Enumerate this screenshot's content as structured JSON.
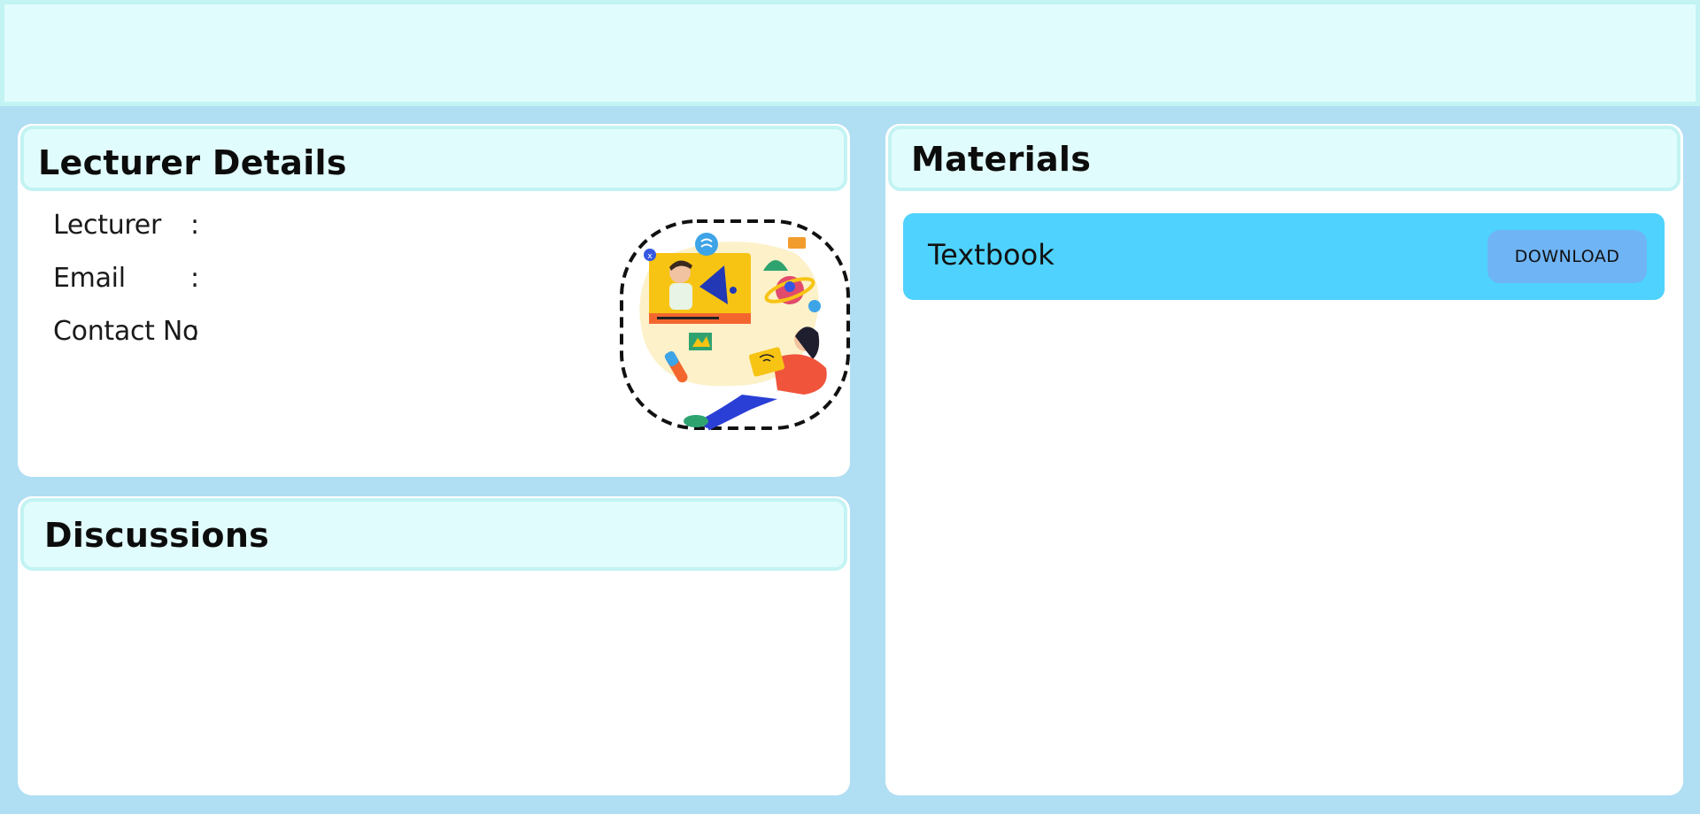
{
  "lecturer_panel": {
    "title": "Lecturer Details",
    "rows": [
      {
        "label": "Lecturer",
        "separator": ":",
        "value": ""
      },
      {
        "label": "Email",
        "separator": ":",
        "value": ""
      },
      {
        "label": "Contact No",
        "separator": ":",
        "value": ""
      }
    ],
    "illustration_icon": "online-learning-illustration"
  },
  "discussions_panel": {
    "title": "Discussions"
  },
  "materials_panel": {
    "title": "Materials",
    "items": [
      {
        "name": "Textbook",
        "action_label": "DOWNLOAD"
      }
    ]
  },
  "colors": {
    "page_background": "#b0def3",
    "header_fill": "#e1fcfc",
    "header_border": "#c3f3f3",
    "material_item": "#4fd2fd",
    "download_button": "#6fb4f5"
  }
}
